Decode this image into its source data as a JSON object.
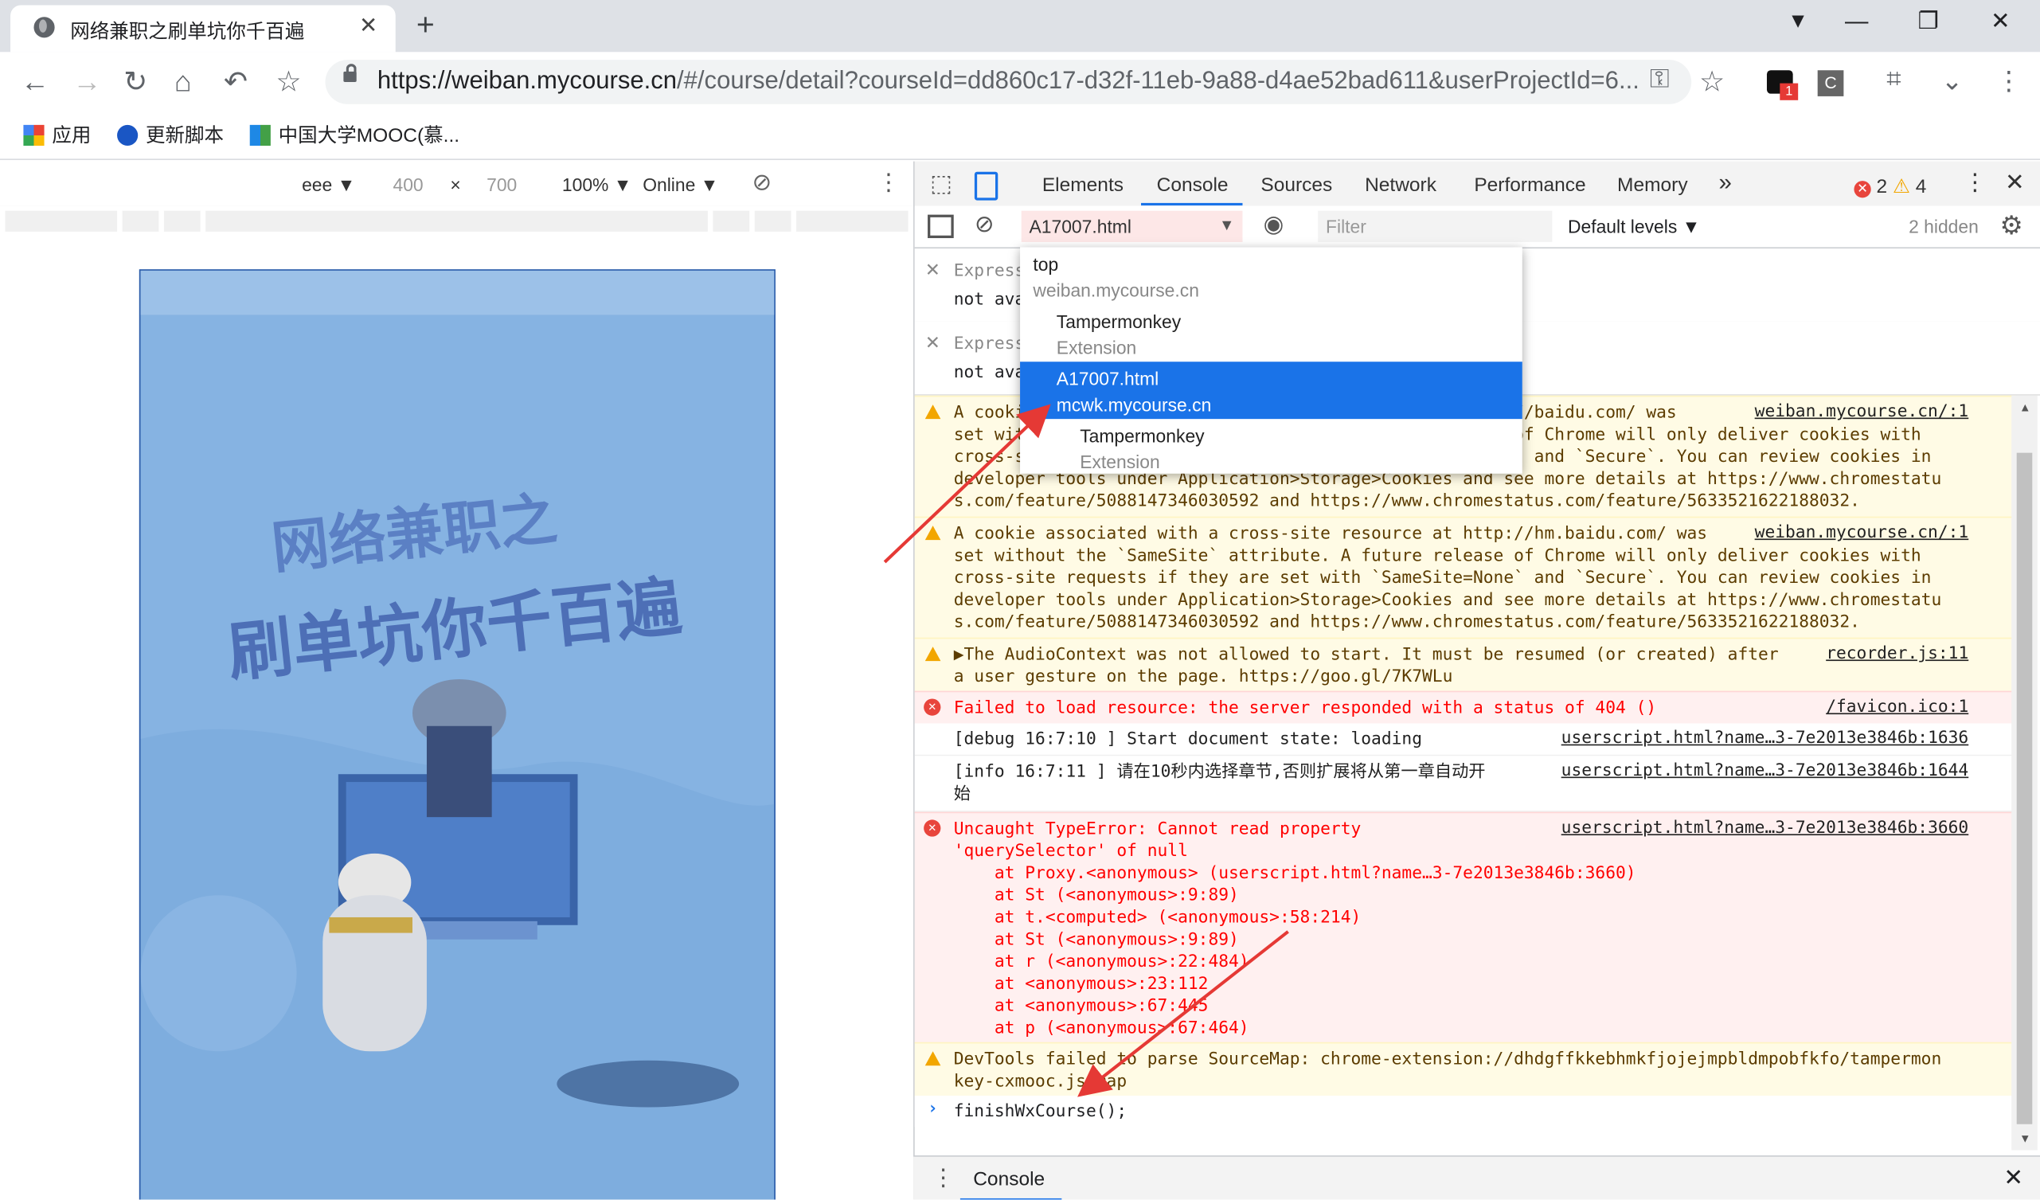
{
  "tab": {
    "title": "网络兼职之刷单坑你千百遍",
    "close": "✕",
    "new_tab": "+"
  },
  "window": {
    "minimize": "—",
    "restore": "❐",
    "close": "✕",
    "tabsearch": "⌄"
  },
  "address": {
    "host": "https://weiban.mycourse.cn",
    "path": "/#/course/detail?courseId=dd860c17-d32f-11eb-9a88-d4ae52bad611&userProjectId=6..."
  },
  "bookmarks": [
    {
      "label": "应用",
      "icon": "apps-icon"
    },
    {
      "label": "更新脚本",
      "icon": "script-icon"
    },
    {
      "label": "中国大学MOOC(慕...",
      "icon": "mooc-icon"
    }
  ],
  "extension_badge": "1",
  "device_toolbar": {
    "device": "eee",
    "width": "400",
    "times": "×",
    "height": "700",
    "zoom": "100%",
    "network": "Online"
  },
  "devtools": {
    "tabs": [
      "Elements",
      "Console",
      "Sources",
      "Network",
      "Performance",
      "Memory"
    ],
    "more": "»",
    "active_tab": "Console",
    "errors": "2",
    "warnings": "4",
    "context": "A17007.html",
    "filter_placeholder": "Filter",
    "levels": "Default levels",
    "hidden": "2 hidden",
    "expressions": [
      {
        "label": "Expression",
        "value": "not available"
      },
      {
        "label": "Expression",
        "value": "not available"
      }
    ],
    "context_menu": [
      {
        "main": "top",
        "sub": "weiban.mycourse.cn",
        "indent": 0,
        "selected": false
      },
      {
        "main": "Tampermonkey",
        "sub": "Extension",
        "indent": 1,
        "selected": false
      },
      {
        "main": "A17007.html",
        "sub": "mcwk.mycourse.cn",
        "indent": 1,
        "selected": true
      },
      {
        "main": "Tampermonkey",
        "sub": "Extension",
        "indent": 2,
        "selected": false
      }
    ],
    "messages": {
      "w1": {
        "lines": [
          "A cookie associated with a cross-site resource at http://baidu.com/ was",
          "set without the `SameSite` attribute. A future release of Chrome will only deliver cookies with",
          "cross-site requests if they are set with `SameSite=None` and `Secure`. You can review cookies in",
          "developer tools under Application>Storage>Cookies and see more details at https://www.chromestatu",
          "s.com/feature/5088147346030592 and https://www.chromestatus.com/feature/5633521622188032."
        ],
        "src": "weiban.mycourse.cn/:1"
      },
      "w2": {
        "lines": [
          "A cookie associated with a cross-site resource at http://hm.baidu.com/ was",
          "set without the `SameSite` attribute. A future release of Chrome will only deliver cookies with",
          "cross-site requests if they are set with `SameSite=None` and `Secure`. You can review cookies in",
          "developer tools under Application>Storage>Cookies and see more details at https://www.chromestatu",
          "s.com/feature/5088147346030592 and https://www.chromestatus.com/feature/5633521622188032."
        ],
        "src": "weiban.mycourse.cn/:1"
      },
      "w3": {
        "lines": [
          "▶The AudioContext was not allowed to start. It must be resumed (or created) after",
          "a user gesture on the page. https://goo.gl/7K7WLu"
        ],
        "src": "recorder.js:11"
      },
      "e1": {
        "text": "Failed to load resource: the server responded with a status of 404 ()",
        "src": "/favicon.ico:1"
      },
      "i1": {
        "text": "[debug 16:7:10 ] Start document state: loading",
        "src": "userscript.html?name…3-7e2013e3846b:1636"
      },
      "i2": {
        "text": "[info 16:7:11 ] 请在10秒内选择章节,否则扩展将从第一章自动开",
        "text2": "始",
        "src": "userscript.html?name…3-7e2013e3846b:1644"
      },
      "e2": {
        "lines": [
          "Uncaught TypeError: Cannot read property",
          "'querySelector' of null",
          "    at Proxy.<anonymous> (userscript.html?name…3-7e2013e3846b:3660)",
          "    at St (<anonymous>:9:89)",
          "    at t.<computed> (<anonymous>:58:214)",
          "    at St (<anonymous>:9:89)",
          "    at r (<anonymous>:22:484)",
          "    at <anonymous>:23:112",
          "    at <anonymous>:67:445",
          "    at p (<anonymous>:67:464)"
        ],
        "src": "userscript.html?name…3-7e2013e3846b:3660"
      },
      "w4": {
        "lines": [
          "DevTools failed to parse SourceMap: chrome-extension://dhdgffkkebhmkfjojejmpbldmpobfkfo/tampermon",
          "key-cxmooc.js.map"
        ]
      }
    },
    "prompt": "finishWxCourse();",
    "drawer_tab": "Console"
  },
  "page_art": {
    "line1": "网络兼职之",
    "line2": "刷单坑你千百遍"
  }
}
